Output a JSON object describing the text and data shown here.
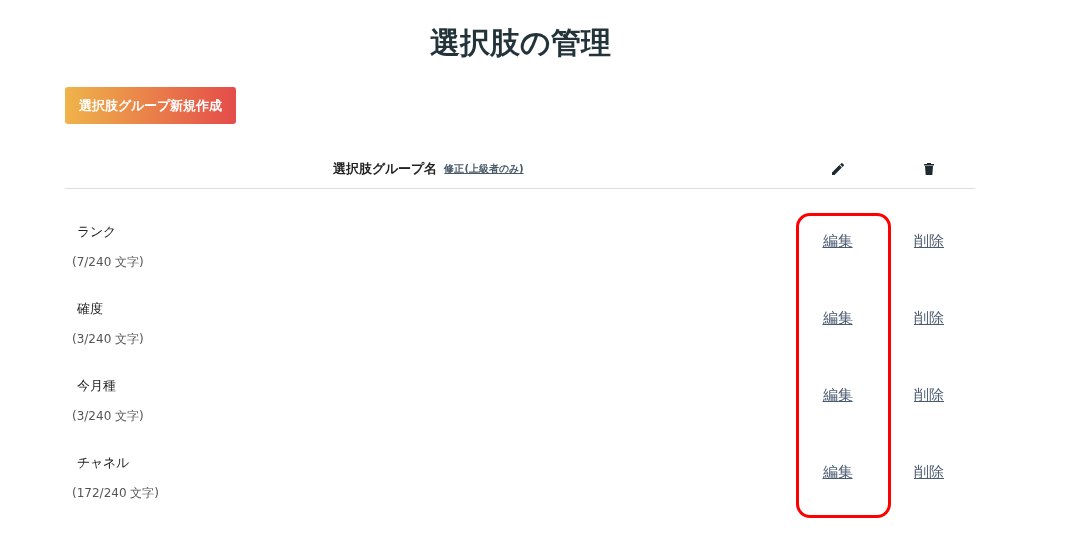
{
  "title": "選択肢の管理",
  "create_button": "選択肢グループ新規作成",
  "table": {
    "columns": [
      {
        "kind": "text",
        "label": "選択肢グループ名",
        "link": "修正(上級者のみ)"
      },
      {
        "kind": "pencil"
      },
      {
        "kind": "trash"
      }
    ],
    "rows": [
      {
        "name": "ランク",
        "count": "(7/240 文字)",
        "edit": "編集",
        "delete": "削除"
      },
      {
        "name": "確度",
        "count": "(3/240 文字)",
        "edit": "編集",
        "delete": "削除"
      },
      {
        "name": "今月種",
        "count": "(3/240 文字)",
        "edit": "編集",
        "delete": "削除"
      },
      {
        "name": "チャネル",
        "count": "(172/240 文字)",
        "edit": "編集",
        "delete": "削除"
      }
    ]
  },
  "edit_column_highlighted": true
}
